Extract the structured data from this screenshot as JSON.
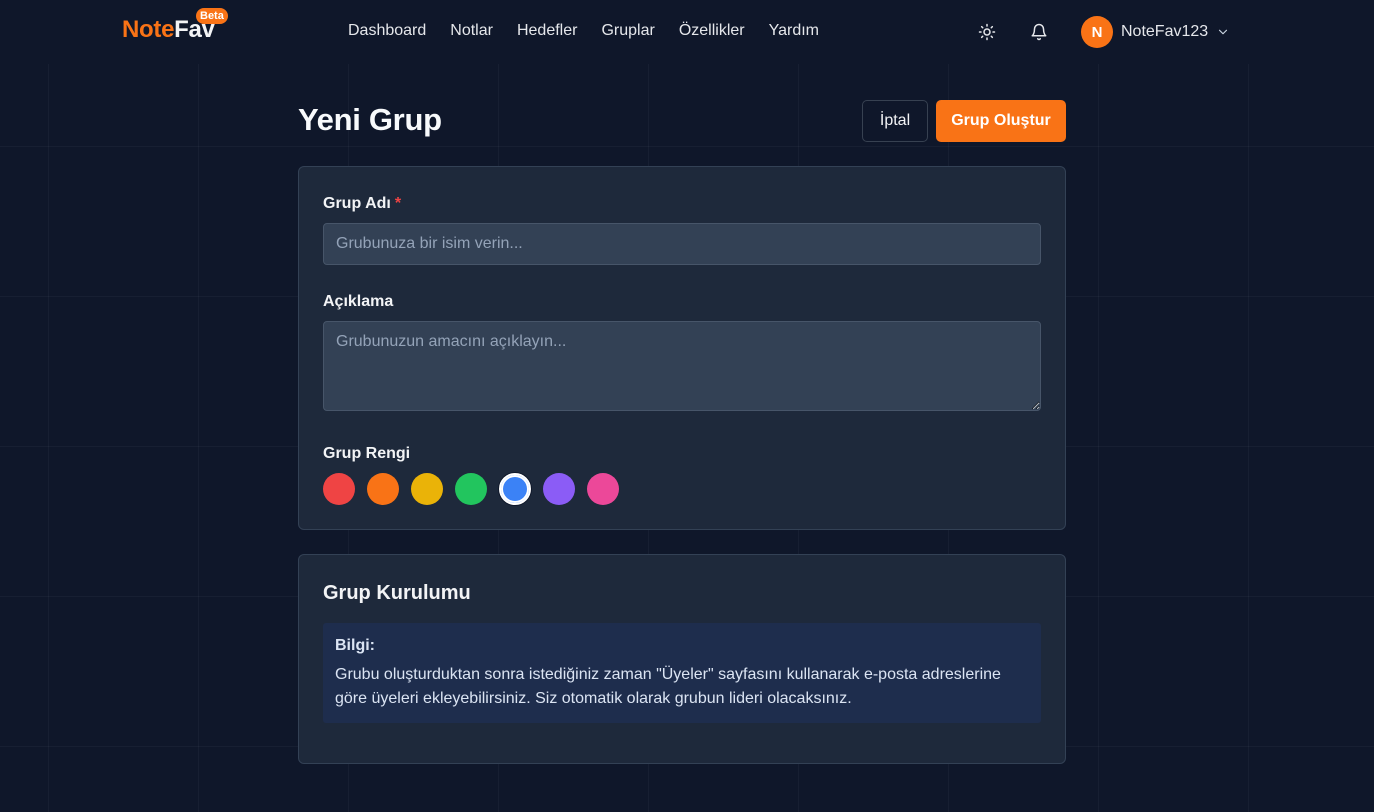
{
  "nav": {
    "logo_part1": "Note",
    "logo_part2": "Fav",
    "beta_badge": "Beta",
    "links": [
      "Dashboard",
      "Notlar",
      "Hedefler",
      "Gruplar",
      "Özellikler",
      "Yardım"
    ],
    "icons": [
      "sun-icon",
      "bell-icon"
    ],
    "user": {
      "initial": "N",
      "name": "NoteFav123"
    }
  },
  "page": {
    "title": "Yeni Grup",
    "cancel_label": "İptal",
    "create_label": "Grup Oluştur"
  },
  "form": {
    "name_label": "Grup Adı",
    "required_mark": "*",
    "name_placeholder": "Grubunuza bir isim verin...",
    "name_value": "",
    "description_label": "Açıklama",
    "description_placeholder": "Grubunuzun amacını açıklayın...",
    "description_value": "",
    "color_label": "Grup Rengi",
    "colors": [
      "#ef4444",
      "#f97316",
      "#eab308",
      "#22c55e",
      "#3b82f6",
      "#8b5cf6",
      "#ec4899"
    ],
    "selected_color": "#3b82f6"
  },
  "setup": {
    "title": "Grup Kurulumu",
    "info_title": "Bilgi:",
    "info_text": "Grubu oluşturduktan sonra istediğiniz zaman \"Üyeler\" sayfasını kullanarak e-posta adreslerine göre üyeleri ekleyebilirsiniz. Siz otomatik olarak grubun lideri olacaksınız."
  },
  "colors": {
    "accent": "#f97316",
    "background": "#0f172a",
    "card": "#1e293b"
  }
}
